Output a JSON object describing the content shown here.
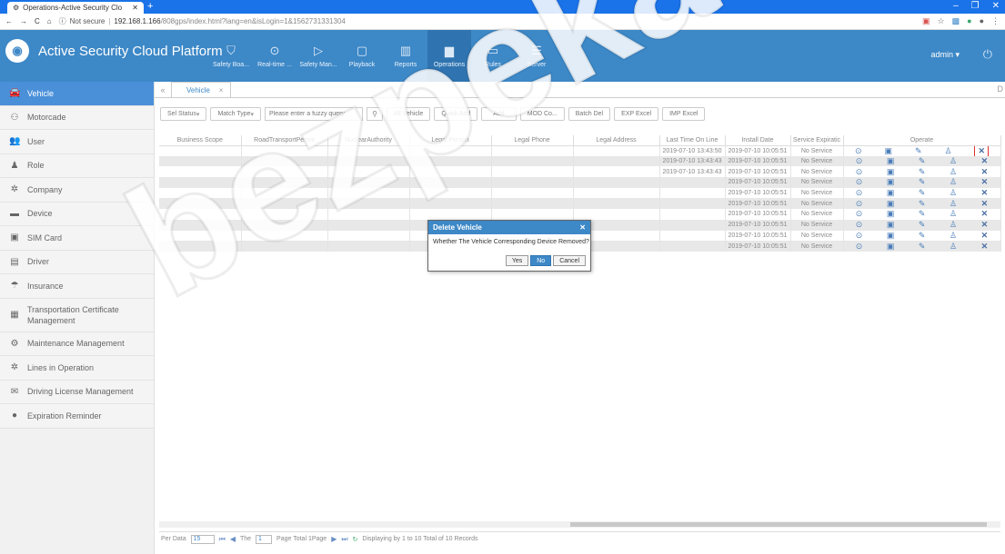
{
  "browser": {
    "tab_title": "Operations-Active Security Clo",
    "new_tab": "+",
    "window_controls": [
      "–",
      "❐",
      "✕"
    ],
    "security": "Not secure",
    "url_host": "192.168.1.166",
    "url_path": "/808gps/index.html?lang=en&isLogin=1&1562731331304"
  },
  "app": {
    "title": "Active Security Cloud Platform",
    "user": "admin",
    "nav": [
      {
        "label": "Safety Boa...",
        "icon": "shield-icon"
      },
      {
        "label": "Real-time ...",
        "icon": "map-pin-icon"
      },
      {
        "label": "Safety Man...",
        "icon": "play-shield-icon"
      },
      {
        "label": "Playback",
        "icon": "playback-icon"
      },
      {
        "label": "Reports",
        "icon": "chart-icon"
      },
      {
        "label": "Operations",
        "icon": "operations-icon"
      },
      {
        "label": "Rules",
        "icon": "rules-icon"
      },
      {
        "label": "Server",
        "icon": "server-icon"
      }
    ]
  },
  "sidebar": {
    "items": [
      {
        "label": "Vehicle",
        "icon": "vehicle-icon",
        "glyph": "🚘"
      },
      {
        "label": "Motorcade",
        "icon": "motorcade-icon",
        "glyph": "⚇"
      },
      {
        "label": "User",
        "icon": "user-icon",
        "glyph": "👥"
      },
      {
        "label": "Role",
        "icon": "role-icon",
        "glyph": "♟"
      },
      {
        "label": "Company",
        "icon": "company-icon",
        "glyph": "✲"
      },
      {
        "label": "Device",
        "icon": "device-icon",
        "glyph": "▬"
      },
      {
        "label": "SIM Card",
        "icon": "sim-card-icon",
        "glyph": "▣"
      },
      {
        "label": "Driver",
        "icon": "driver-icon",
        "glyph": "▤"
      },
      {
        "label": "Insurance",
        "icon": "insurance-icon",
        "glyph": "☂"
      },
      {
        "label": "Transportation Certificate Management",
        "icon": "certificate-icon",
        "glyph": "▦"
      },
      {
        "label": "Maintenance Management",
        "icon": "maintenance-icon",
        "glyph": "⚙"
      },
      {
        "label": "Lines in Operation",
        "icon": "lines-icon",
        "glyph": "✲"
      },
      {
        "label": "Driving License Management",
        "icon": "license-icon",
        "glyph": "✉"
      },
      {
        "label": "Expiration Reminder",
        "icon": "reminder-icon",
        "glyph": "●"
      }
    ]
  },
  "content_tab": {
    "label": "Vehicle",
    "close": "×",
    "right_edge": "D"
  },
  "toolbar": {
    "sel_status": "Sel Status",
    "match_type": "Match Type",
    "search_placeholder": "Please enter a fuzzy query",
    "buttons": [
      "All Vehicle",
      "Quick Add",
      "Add",
      "MOD Co...",
      "Batch Del",
      "EXP Excel",
      "IMP Excel"
    ]
  },
  "table": {
    "headers": [
      "Business Scope",
      "RoadTransportPermit",
      "NuclearAuthority",
      "Legal Person",
      "Legal Phone",
      "Legal Address",
      "Last Time On Line",
      "Install Date",
      "Service Expiratic",
      "Operate"
    ],
    "rows": [
      {
        "last_online": "2019-07-10 13:43:50",
        "install": "2019-07-10 10:05:51",
        "service": "No Service"
      },
      {
        "last_online": "2019-07-10 13:43:43",
        "install": "2019-07-10 10:05:51",
        "service": "No Service"
      },
      {
        "last_online": "2019-07-10 13:43:43",
        "install": "2019-07-10 10:05:51",
        "service": "No Service"
      },
      {
        "last_online": "",
        "install": "2019-07-10 10:05:51",
        "service": "No Service"
      },
      {
        "last_online": "",
        "install": "2019-07-10 10:05:51",
        "service": "No Service"
      },
      {
        "last_online": "",
        "install": "2019-07-10 10:05:51",
        "service": "No Service"
      },
      {
        "last_online": "",
        "install": "2019-07-10 10:05:51",
        "service": "No Service"
      },
      {
        "last_online": "",
        "install": "2019-07-10 10:05:51",
        "service": "No Service"
      },
      {
        "last_online": "",
        "install": "2019-07-10 10:05:51",
        "service": "No Service"
      },
      {
        "last_online": "",
        "install": "2019-07-10 10:05:51",
        "service": "No Service"
      }
    ]
  },
  "pager": {
    "per_data_label": "Per Data",
    "per_data_value": "15",
    "the_label": "The",
    "page_value": "1",
    "page_total": "Page  Total 1Page",
    "summary": "Displaying by 1 to 10 Total of 10 Records"
  },
  "dialog": {
    "title": "Delete  Vehicle",
    "message": "Whether The Vehicle Corresponding Device Removed?",
    "yes": "Yes",
    "no": "No",
    "cancel": "Cancel"
  },
  "watermark": "bezpeka-SI"
}
